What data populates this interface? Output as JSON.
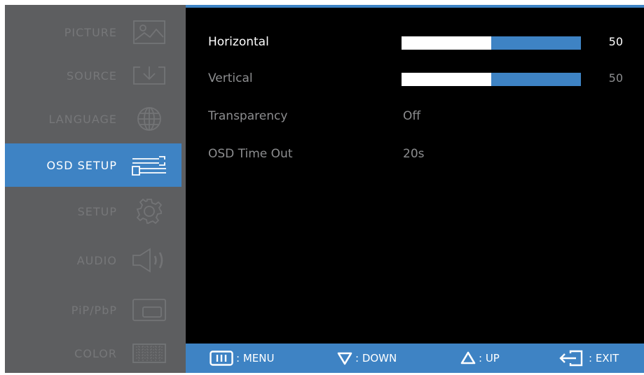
{
  "sidebar": {
    "items": [
      {
        "label": "PICTURE",
        "icon": "picture-icon",
        "active": false
      },
      {
        "label": "SOURCE",
        "icon": "source-icon",
        "active": false
      },
      {
        "label": "LANGUAGE",
        "icon": "globe-icon",
        "active": false
      },
      {
        "label": "OSD SETUP",
        "icon": "osd-setup-icon",
        "active": true
      },
      {
        "label": "SETUP",
        "icon": "gear-icon",
        "active": false
      },
      {
        "label": "AUDIO",
        "icon": "speaker-icon",
        "active": false
      },
      {
        "label": "PiP/PbP",
        "icon": "pip-icon",
        "active": false
      },
      {
        "label": "COLOR",
        "icon": "color-icon",
        "active": false
      }
    ]
  },
  "settings": {
    "horizontal": {
      "label": "Horizontal",
      "value": "50",
      "level": 0.5
    },
    "vertical": {
      "label": "Vertical",
      "value": "50",
      "level": 0.5
    },
    "transparency": {
      "label": "Transparency",
      "value": "Off"
    },
    "timeout": {
      "label": "OSD Time Out",
      "value": "20s"
    }
  },
  "footer": {
    "menu": ": MENU",
    "down": ": DOWN",
    "up": ": UP",
    "exit": ": EXIT"
  },
  "colors": {
    "accent": "#3e83c4",
    "panel": "#5d5e60",
    "background": "#000000"
  }
}
